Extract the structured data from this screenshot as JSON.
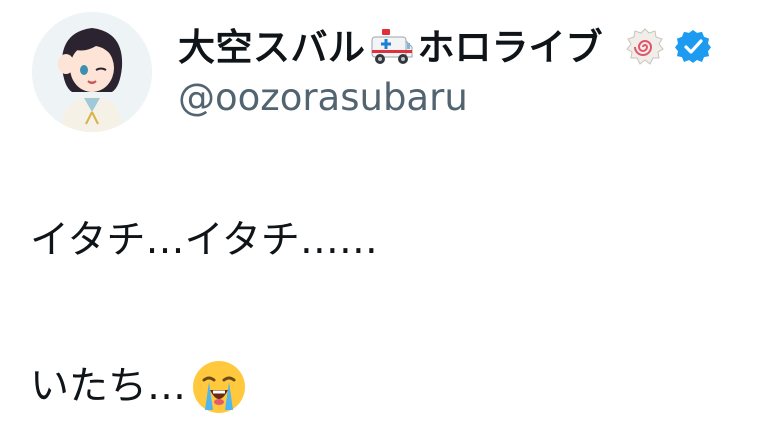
{
  "profile": {
    "display_name": "大空スバル",
    "name_suffix": "ホロライブ",
    "name_emoji": "ambulance-icon",
    "badge_emoji": "narutomaki-icon",
    "verified_icon": "verified-badge-icon",
    "handle": "@oozorasubaru",
    "avatar": "avatar"
  },
  "tweet": {
    "lines": [
      "イタチ…イタチ……",
      "",
      "いたち…"
    ],
    "trailing_emoji": "loudly-crying-face-icon"
  },
  "colors": {
    "text": "#0f1419",
    "handle": "#536471",
    "verified": "#1d9bf0"
  }
}
